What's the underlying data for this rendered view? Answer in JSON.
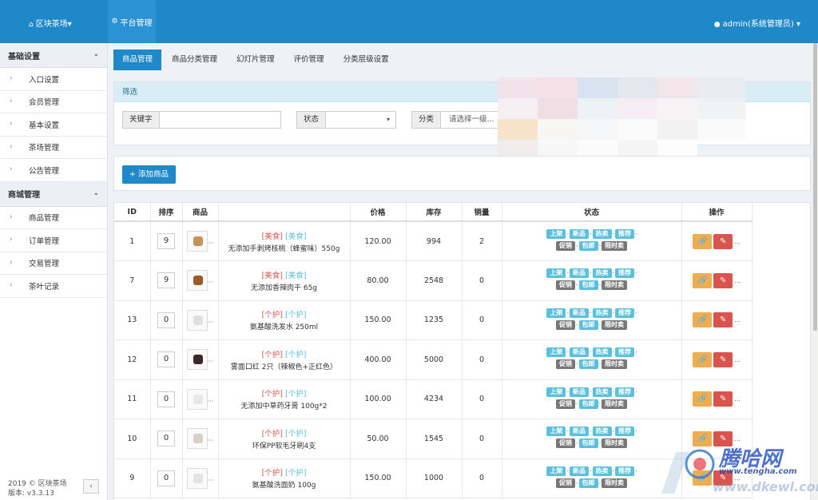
{
  "header": {
    "brand": "区块茶场",
    "brand_caret": "▾",
    "active_tab": "平台管理",
    "user": "admin(系统管理员)",
    "user_caret": "▾"
  },
  "sidebar": {
    "groups": [
      {
        "label": "基础设置",
        "items": [
          "入口设置",
          "会员管理",
          "基本设置",
          "茶场管理",
          "公告管理"
        ]
      },
      {
        "label": "商城管理",
        "items": [
          "商品管理",
          "订单管理",
          "交易管理",
          "茶叶记录"
        ]
      }
    ],
    "footer_copyright": "2019 © 区块茶场",
    "footer_version": "版本: v3.3.13",
    "collapse_label": "‹"
  },
  "tabs": [
    "商品管理",
    "商品分类管理",
    "幻灯片管理",
    "评价管理",
    "分类层级设置"
  ],
  "filter": {
    "title": "筛选",
    "keyword_label": "关键字",
    "keyword_value": "",
    "status_label": "状态",
    "status_value": "",
    "category_label": "分类",
    "category_placeholder": "请选择一级..."
  },
  "toolbar": {
    "add_label": "添加商品",
    "add_icon": "+"
  },
  "table": {
    "headers": [
      "ID",
      "排序",
      "商品",
      "",
      "价格",
      "库存",
      "销量",
      "状态",
      "操作"
    ],
    "status_badges_row1": [
      "上架",
      "新品",
      "热卖",
      "推荐"
    ],
    "status_badges_row2": [
      "促销",
      "包邮",
      "限时卖"
    ],
    "rows": [
      {
        "id": "1",
        "sort": "9",
        "tag1": "[美食]",
        "tag2": "[美食]",
        "name": "无添加手剥烤核桃（蜂蜜味）550g",
        "price": "120.00",
        "stock": "994",
        "sales": "2",
        "thumb_color": "#c8905a"
      },
      {
        "id": "7",
        "sort": "9",
        "tag1": "[美食]",
        "tag2": "[美食]",
        "name": "无添加香辣肉干 65g",
        "price": "80.00",
        "stock": "2548",
        "sales": "0",
        "thumb_color": "#9a5a2a"
      },
      {
        "id": "13",
        "sort": "0",
        "tag1": "[个护]",
        "tag2": "[个护]",
        "name": "氨基酸洗发水 250ml",
        "price": "150.00",
        "stock": "1235",
        "sales": "0",
        "thumb_color": "#e0e0e0"
      },
      {
        "id": "12",
        "sort": "0",
        "tag1": "[个护]",
        "tag2": "[个护]",
        "name": "雾面口红 2只（辣椒色+正红色）",
        "price": "400.00",
        "stock": "5000",
        "sales": "0",
        "thumb_color": "#3a2a2a"
      },
      {
        "id": "11",
        "sort": "0",
        "tag1": "[个护]",
        "tag2": "[个护]",
        "name": "无添加中草药牙膏 100g*2",
        "price": "100.00",
        "stock": "4234",
        "sales": "0",
        "thumb_color": "#e8e8e8"
      },
      {
        "id": "10",
        "sort": "0",
        "tag1": "[个护]",
        "tag2": "[个护]",
        "name": "环保PP软毛牙刷4支",
        "price": "50.00",
        "stock": "1545",
        "sales": "0",
        "thumb_color": "#d8d0c4"
      },
      {
        "id": "9",
        "sort": "0",
        "tag1": "[个护]",
        "tag2": "[个护]",
        "name": "氨基酸洗面奶 100g",
        "price": "150.00",
        "stock": "1000",
        "sales": "0",
        "thumb_color": "#e4e4e4"
      }
    ],
    "more": "..."
  },
  "watermark": {
    "brand": "腾哈网",
    "site1": "www.tenghа.com",
    "site2": "www.dkewl.com"
  },
  "colors": {
    "primary": "#1e88c9",
    "info": "#5bc0de",
    "danger": "#d9534f",
    "warning": "#f0ad4e"
  }
}
